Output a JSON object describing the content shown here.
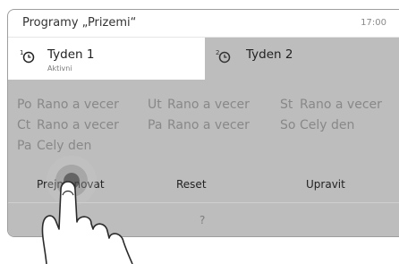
{
  "header": {
    "title": "Programy „Prizemi“",
    "time": "17:00"
  },
  "tabs": [
    {
      "label": "Tyden 1",
      "sublabel": "Aktivni",
      "icon": "week-1-clock-icon",
      "active": true
    },
    {
      "label": "Tyden 2",
      "icon": "week-2-clock-icon",
      "active": false
    }
  ],
  "schedule": [
    [
      {
        "day": "Po",
        "program": "Rano a vecer"
      },
      {
        "day": "Ut",
        "program": "Rano a vecer"
      },
      {
        "day": "St",
        "program": "Rano a vecer"
      }
    ],
    [
      {
        "day": "Ct",
        "program": "Rano a vecer"
      },
      {
        "day": "Pa",
        "program": "Rano a vecer"
      },
      {
        "day": "So",
        "program": "Cely den"
      }
    ],
    [
      {
        "day": "Pa",
        "program": "Cely den"
      }
    ]
  ],
  "actions": {
    "rename": "Prejmenovat",
    "reset": "Reset",
    "edit": "Upravit"
  },
  "help": {
    "label": "?"
  },
  "colors": {
    "overlay": "#bdbdbd",
    "active_tab": "#ffffff",
    "text_dim": "#888888"
  }
}
